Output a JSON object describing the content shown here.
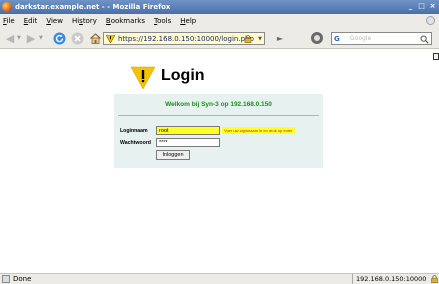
{
  "window": {
    "title": "darkstar.example.net - - Mozilla Firefox",
    "buttons": [
      "_",
      "□",
      "×"
    ]
  },
  "menu": {
    "items": [
      {
        "pre": "",
        "key": "F",
        "post": "ile"
      },
      {
        "pre": "",
        "key": "E",
        "post": "dit"
      },
      {
        "pre": "",
        "key": "V",
        "post": "iew"
      },
      {
        "pre": "Hi",
        "key": "s",
        "post": "tory"
      },
      {
        "pre": "",
        "key": "B",
        "post": "ookmarks"
      },
      {
        "pre": "",
        "key": "T",
        "post": "ools"
      },
      {
        "pre": "",
        "key": "H",
        "post": "elp"
      }
    ]
  },
  "navbar": {
    "url": "https://192.168.0.150:10000/login.php",
    "search_placeholder": "Google",
    "search_engine_letter": "G"
  },
  "page": {
    "logo_title": "Login",
    "welcome": "Welkom bij Syn-3 op 192.168.0.150",
    "username_label": "Loginnaam",
    "username_value": "root",
    "username_hint": "Voer uw loginnaam in en druk op enter",
    "password_label": "Wachtwoord",
    "password_value": "****",
    "submit_label": "Inloggen"
  },
  "status": {
    "text": "Done",
    "host": "192.168.0.150:10000"
  },
  "colors": {
    "welcome": "#1a8f1a",
    "panel": "#e6f1f0",
    "input_highlight": "#ffff22",
    "url_bar": "#fffbd0",
    "logo_yellow": "#f5c400"
  }
}
